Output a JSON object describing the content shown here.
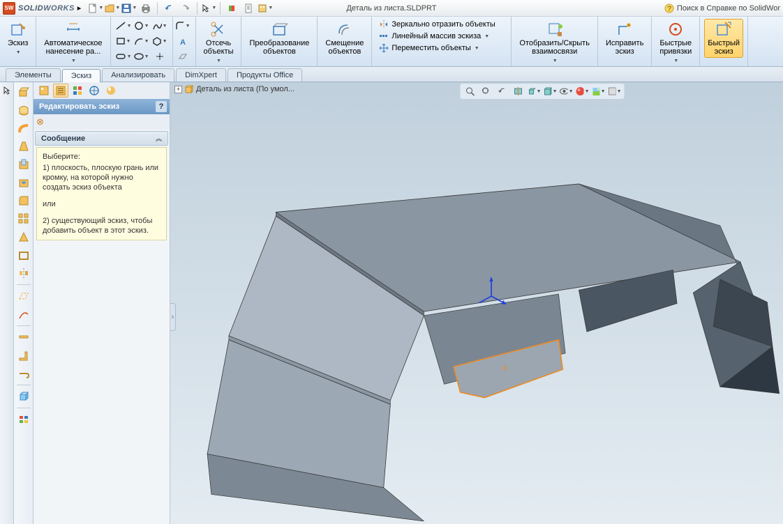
{
  "app": {
    "brand_1": "SOLID",
    "brand_2": "WORKS"
  },
  "qat": {
    "new": "new",
    "open": "open",
    "save": "save",
    "print": "print",
    "undo": "undo",
    "redo": "redo",
    "select": "select",
    "rebuild": "rebuild",
    "options": "options",
    "doc": "doc"
  },
  "document_title": "Деталь из листа.SLDPRT",
  "help_search": "Поиск в Справке по SolidWor",
  "ribbon": {
    "sketch": "Эскиз",
    "smart_dim": "Автоматическое\nнанесение ра...",
    "trim": "Отсечь\nобъекты",
    "convert": "Преобразование\nобъектов",
    "offset": "Смещение\nобъектов",
    "mirror": "Зеркально отразить объекты",
    "linear": "Линейный массив эскиза",
    "move": "Переместить объекты",
    "display": "Отобразить/Скрыть\nвзаимосвязи",
    "repair": "Исправить\nэскиз",
    "quick_snaps": "Быстрые\nпривязки",
    "rapid_sketch": "Быстрый\nэскиз"
  },
  "tabs": {
    "features": "Элементы",
    "sketch": "Эскиз",
    "evaluate": "Анализировать",
    "dimxpert": "DimXpert",
    "office": "Продукты Office"
  },
  "tree_breadcrumb": "Деталь из листа  (По умол...",
  "propman": {
    "title": "Редактировать эскиз",
    "section": "Сообщение",
    "body_select": "Выберите:",
    "body_1": "1) плоскость, плоскую грань или кромку, на которой нужно создать эскиз объекта",
    "body_or": "или",
    "body_2": "2) существующий эскиз, чтобы добавить объект в этот эскиз."
  }
}
